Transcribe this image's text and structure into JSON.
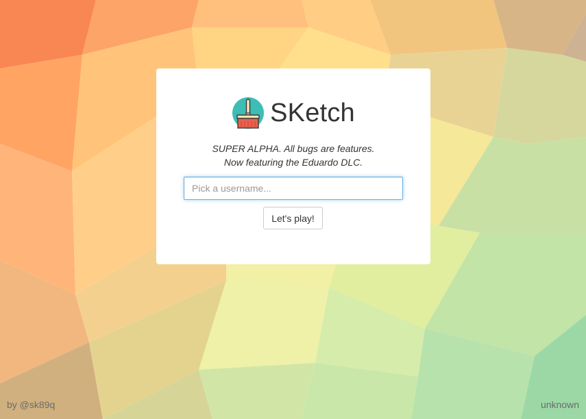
{
  "app": {
    "title": "SKetch",
    "logo_icon": "paintbrush-icon",
    "tagline_line1": "SUPER ALPHA. All bugs are features.",
    "tagline_line2": "Now featuring the Eduardo DLC."
  },
  "form": {
    "username_placeholder": "Pick a username...",
    "username_value": "",
    "play_label": "Let's play!"
  },
  "footer": {
    "credit": "by @sk89q",
    "status": "unknown"
  },
  "colors": {
    "logo_circle": "#3dbdb5",
    "logo_brush": "#e8604c",
    "input_focus": "#66afe9"
  }
}
